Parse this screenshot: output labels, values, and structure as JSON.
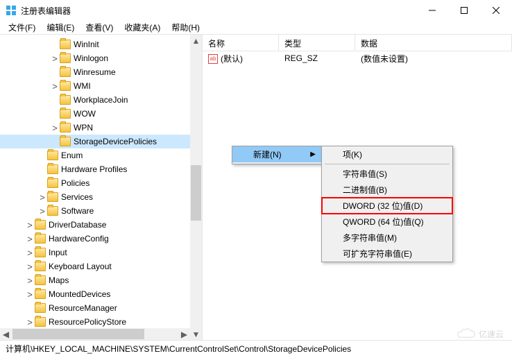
{
  "window": {
    "title": "注册表编辑器"
  },
  "menu": {
    "file": "文件(F)",
    "edit": "编辑(E)",
    "view": "查看(V)",
    "favorites": "收藏夹(A)",
    "help": "帮助(H)"
  },
  "tree": {
    "items": [
      {
        "depth": 4,
        "twisty": "none",
        "label": "WinInit"
      },
      {
        "depth": 4,
        "twisty": "closed",
        "label": "Winlogon"
      },
      {
        "depth": 4,
        "twisty": "none",
        "label": "Winresume"
      },
      {
        "depth": 4,
        "twisty": "closed",
        "label": "WMI"
      },
      {
        "depth": 4,
        "twisty": "none",
        "label": "WorkplaceJoin"
      },
      {
        "depth": 4,
        "twisty": "none",
        "label": "WOW"
      },
      {
        "depth": 4,
        "twisty": "closed",
        "label": "WPN"
      },
      {
        "depth": 4,
        "twisty": "none",
        "label": "StorageDevicePolicies",
        "selected": true
      },
      {
        "depth": 3,
        "twisty": "none",
        "label": "Enum"
      },
      {
        "depth": 3,
        "twisty": "none",
        "label": "Hardware Profiles"
      },
      {
        "depth": 3,
        "twisty": "none",
        "label": "Policies"
      },
      {
        "depth": 3,
        "twisty": "closed",
        "label": "Services"
      },
      {
        "depth": 3,
        "twisty": "closed",
        "label": "Software"
      },
      {
        "depth": 2,
        "twisty": "closed",
        "label": "DriverDatabase"
      },
      {
        "depth": 2,
        "twisty": "closed",
        "label": "HardwareConfig"
      },
      {
        "depth": 2,
        "twisty": "closed",
        "label": "Input"
      },
      {
        "depth": 2,
        "twisty": "closed",
        "label": "Keyboard Layout"
      },
      {
        "depth": 2,
        "twisty": "closed",
        "label": "Maps"
      },
      {
        "depth": 2,
        "twisty": "closed",
        "label": "MountedDevices"
      },
      {
        "depth": 2,
        "twisty": "none",
        "label": "ResourceManager"
      },
      {
        "depth": 2,
        "twisty": "closed",
        "label": "ResourcePolicyStore"
      }
    ]
  },
  "list": {
    "headers": {
      "name": "名称",
      "type": "类型",
      "data": "数据"
    },
    "rows": [
      {
        "name": "(默认)",
        "type": "REG_SZ",
        "data": "(数值未设置)"
      }
    ]
  },
  "context": {
    "new": "新建(N)",
    "sub": {
      "key": "项(K)",
      "string": "字符串值(S)",
      "binary": "二进制值(B)",
      "dword": "DWORD (32 位)值(D)",
      "qword": "QWORD (64 位)值(Q)",
      "multi": "多字符串值(M)",
      "expand": "可扩充字符串值(E)"
    }
  },
  "status": {
    "path": "计算机\\HKEY_LOCAL_MACHINE\\SYSTEM\\CurrentControlSet\\Control\\StorageDevicePolicies"
  },
  "watermark": {
    "text": "亿速云"
  }
}
